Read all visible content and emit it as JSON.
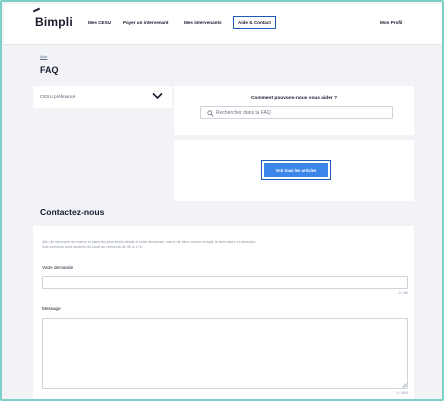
{
  "header": {
    "logo": "Bimpli",
    "nav": [
      {
        "label": "Mes CESU"
      },
      {
        "label": "Payer un intervenant"
      },
      {
        "label": "Mes intervenants"
      },
      {
        "label": "Aide & Contact"
      }
    ],
    "profile": "Mon Profil",
    "active_index": 3
  },
  "breadcrumb": "Aide",
  "faq": {
    "title": "FAQ",
    "category_select": "CESU préfinancé",
    "help_title": "Comment pouvons-nous vous aider ?",
    "search_placeholder": "Rechercher dans la FAQ",
    "articles_button": "Voir tous les articles"
  },
  "contact": {
    "title": "Contactez-nous",
    "intro_line1": "Afin de répondre au mieux et dans les plus brefs délais à votre demande, merci de bien vouloir remplir le formulaire ci-dessous.",
    "intro_line2": "Nos services sont ouverts du lundi au vendredi de 9h à 17h.",
    "request_label": "Votre demande",
    "request_counter": "0 / 50",
    "message_label": "Message",
    "message_counter": "0 / 800"
  },
  "colors": {
    "accent": "#3b86e8",
    "focus_border": "#1e5ab8",
    "frame": "#7ecfc8",
    "background": "#f1f3f7"
  }
}
